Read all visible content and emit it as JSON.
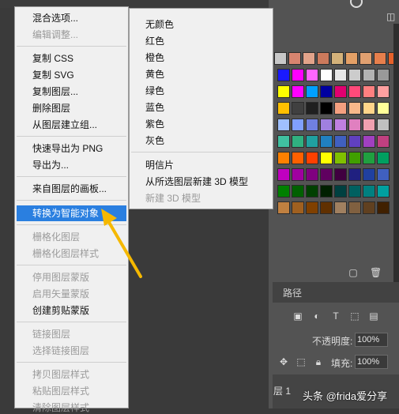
{
  "menu": {
    "items": [
      {
        "label": "混合选项...",
        "disabled": false
      },
      {
        "label": "编辑调整...",
        "disabled": true
      },
      {
        "label": "复制 CSS",
        "disabled": false
      },
      {
        "label": "复制 SVG",
        "disabled": false
      },
      {
        "label": "复制图层...",
        "disabled": false
      },
      {
        "label": "删除图层",
        "disabled": false
      },
      {
        "label": "从图层建立组...",
        "disabled": false
      },
      {
        "label": "快速导出为 PNG",
        "disabled": false
      },
      {
        "label": "导出为...",
        "disabled": false
      },
      {
        "label": "来自图层的画板...",
        "disabled": false
      },
      {
        "label": "转换为智能对象",
        "disabled": false,
        "highlighted": true
      },
      {
        "label": "栅格化图层",
        "disabled": true
      },
      {
        "label": "栅格化图层样式",
        "disabled": true
      },
      {
        "label": "停用图层蒙版",
        "disabled": true
      },
      {
        "label": "启用矢量蒙版",
        "disabled": true
      },
      {
        "label": "创建剪贴蒙版",
        "disabled": false
      },
      {
        "label": "链接图层",
        "disabled": true
      },
      {
        "label": "选择链接图层",
        "disabled": true
      },
      {
        "label": "拷贝图层样式",
        "disabled": true
      },
      {
        "label": "粘贴图层样式",
        "disabled": true
      },
      {
        "label": "清除图层样式",
        "disabled": true
      }
    ],
    "highlight_color": "#2a7fe0"
  },
  "submenu": {
    "items": [
      {
        "label": "无颜色",
        "disabled": false
      },
      {
        "label": "红色",
        "disabled": false
      },
      {
        "label": "橙色",
        "disabled": false
      },
      {
        "label": "黄色",
        "disabled": false
      },
      {
        "label": "绿色",
        "disabled": false
      },
      {
        "label": "蓝色",
        "disabled": false
      },
      {
        "label": "紫色",
        "disabled": false
      },
      {
        "label": "灰色",
        "disabled": false
      },
      {
        "label": "明信片",
        "disabled": false
      },
      {
        "label": "从所选图层新建 3D 模型",
        "disabled": false
      },
      {
        "label": "新建 3D 模型",
        "disabled": true
      }
    ]
  },
  "panel": {
    "path_tab": "路径",
    "opacity_label": "不透明度:",
    "opacity_value": "100%",
    "fill_label": "填充:",
    "fill_value": "100%",
    "layer_name": "层 1"
  },
  "watermark": "头条 @frida爱分享",
  "annotation_color": "#f5b800",
  "swatches": [
    [
      "#c8c8c8",
      "#d7846f",
      "#e2a38a",
      "#cc7a5c",
      "#d4b27a",
      "#e4a066",
      "#e0a070",
      "#e77f4c",
      "#e5612a"
    ],
    [
      "#1a1aff",
      "#ff00ff",
      "#ff66ff",
      "#ffffff",
      "#e6e6e6",
      "#cccccc",
      "#b3b3b3",
      "#999999"
    ],
    [
      "#ffff00",
      "#ff00ff",
      "#00a0ff",
      "#0000a0",
      "#e00070",
      "#ff4a7a",
      "#ff8080",
      "#ffa0a0"
    ],
    [
      "#ffc000",
      "#404040",
      "#202020",
      "#000000",
      "#f4a080",
      "#f8b88a",
      "#ffd58a",
      "#ffff99"
    ],
    [
      "#a0c0ff",
      "#80a0ff",
      "#7080e0",
      "#a080e0",
      "#c080e0",
      "#e080c0",
      "#f0a0b0",
      "#c0c0c0"
    ],
    [
      "#40c0a0",
      "#30b080",
      "#20a0a0",
      "#2080c0",
      "#4060c0",
      "#6040c0",
      "#a040c0",
      "#c04080"
    ],
    [
      "#ff8000",
      "#ff6000",
      "#ff4000",
      "#ffff00",
      "#80c000",
      "#40a000",
      "#20a040",
      "#00a060"
    ],
    [
      "#c000c0",
      "#a000a0",
      "#800080",
      "#600060",
      "#400040",
      "#202080",
      "#2040a0",
      "#4060c0"
    ],
    [
      "#008000",
      "#006000",
      "#004000",
      "#002000",
      "#004040",
      "#006060",
      "#008080",
      "#00a0a0"
    ],
    [
      "#c08040",
      "#a06020",
      "#804000",
      "#603000",
      "#a08060",
      "#806040",
      "#604020",
      "#402000"
    ]
  ]
}
